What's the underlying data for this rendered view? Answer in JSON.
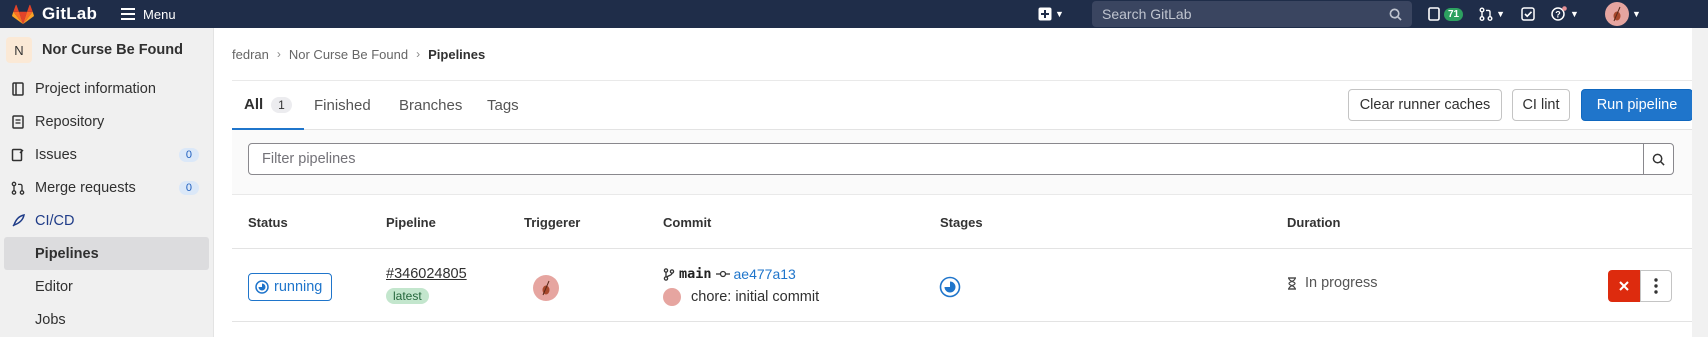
{
  "navbar": {
    "brand": "GitLab",
    "menu_label": "Menu",
    "search_placeholder": "Search GitLab",
    "todos_count": "71",
    "icons": [
      "tanuki-logo",
      "hamburger-icon",
      "plus-square-icon",
      "search-icon",
      "issues-icon",
      "merge-request-icon",
      "todo-check-icon",
      "help-icon",
      "user-avatar"
    ],
    "background_color": "#1f2d49",
    "todos_badge_color": "#2da160"
  },
  "sidebar": {
    "project_initial": "N",
    "project_name": "Nor Curse Be Found",
    "items": [
      {
        "label": "Project information",
        "icon": "project-icon"
      },
      {
        "label": "Repository",
        "icon": "doc-icon"
      },
      {
        "label": "Issues",
        "icon": "issues-icon",
        "count": "0"
      },
      {
        "label": "Merge requests",
        "icon": "merge-request-icon",
        "count": "0"
      },
      {
        "label": "CI/CD",
        "icon": "rocket-icon"
      }
    ],
    "sub_items": [
      "Pipelines",
      "Editor",
      "Jobs"
    ],
    "selected_sub_item": "Pipelines"
  },
  "breadcrumb": {
    "items": [
      "fedran",
      "Nor Curse Be Found",
      "Pipelines"
    ]
  },
  "tabs": {
    "items": [
      {
        "label": "All",
        "count": "1",
        "active": true
      },
      {
        "label": "Finished"
      },
      {
        "label": "Branches"
      },
      {
        "label": "Tags"
      }
    ]
  },
  "actions": {
    "clear_caches": "Clear runner caches",
    "ci_lint": "CI lint",
    "run_pipeline": "Run pipeline",
    "primary_color": "#1f75cb"
  },
  "filter": {
    "placeholder": "Filter pipelines"
  },
  "table": {
    "headers": [
      "Status",
      "Pipeline",
      "Triggerer",
      "Commit",
      "Stages",
      "Duration"
    ],
    "rows": [
      {
        "status": "running",
        "pipeline_id": "#346024805",
        "pipeline_badge": "latest",
        "branch": "main",
        "sha": "ae477a13",
        "commit_message": "chore: initial commit",
        "duration": "In progress"
      }
    ],
    "cancel_color": "#dd2b0e"
  }
}
